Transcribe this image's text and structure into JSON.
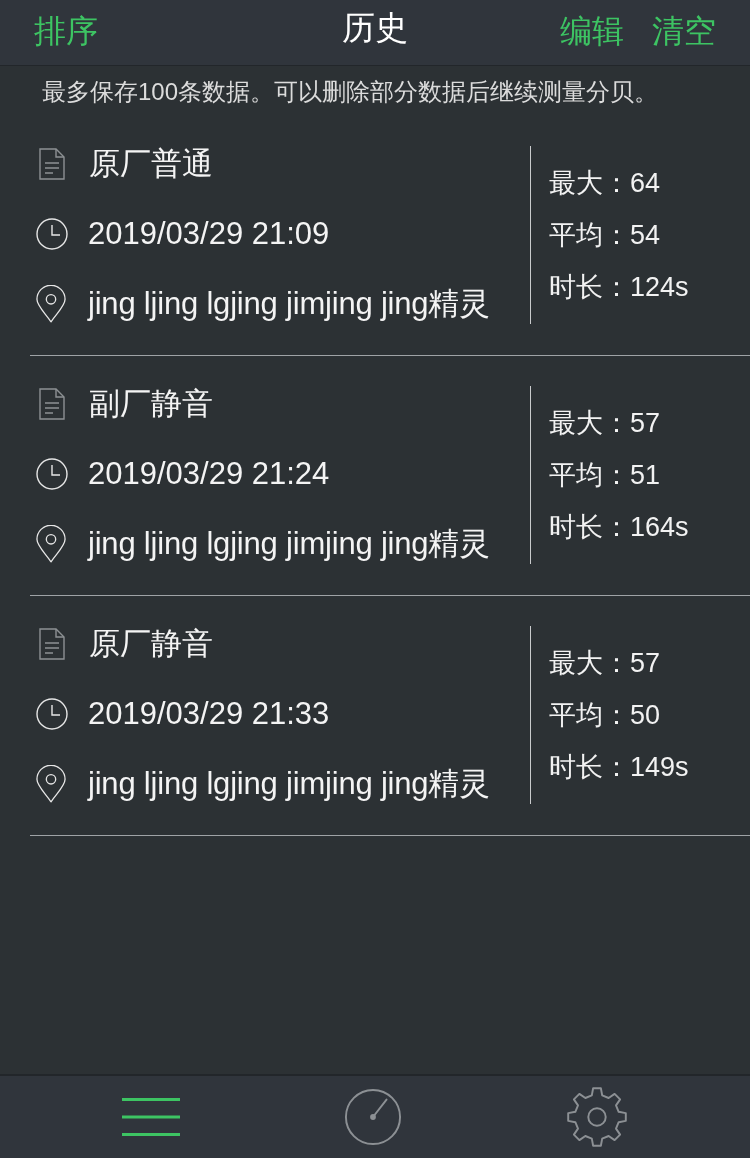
{
  "header": {
    "left_action": "排序",
    "title": "历史",
    "right_actions": [
      "编辑",
      "清空"
    ]
  },
  "notice": "最多保存100条数据。可以删除部分数据后继续测量分贝。",
  "records": [
    {
      "name": "原厂普通",
      "time": "2019/03/29 21:09",
      "location": "jing ljing lgjing jimjing jing精灵",
      "stats": [
        "最大：64",
        "平均：54",
        "时长：124s"
      ]
    },
    {
      "name": "副厂静音",
      "time": "2019/03/29 21:24",
      "location": "jing ljing lgjing jimjing jing精灵",
      "stats": [
        "最大：57",
        "平均：51",
        "时长：164s"
      ]
    },
    {
      "name": "原厂静音",
      "time": "2019/03/29 21:33",
      "location": "jing ljing lgjing jimjing jing精灵",
      "stats": [
        "最大：57",
        "平均：50",
        "时长：149s"
      ]
    }
  ],
  "tab_bar": [
    {
      "kind": "menu",
      "selected": true
    },
    {
      "kind": "gauge",
      "selected": false
    },
    {
      "kind": "settings",
      "selected": false
    }
  ]
}
